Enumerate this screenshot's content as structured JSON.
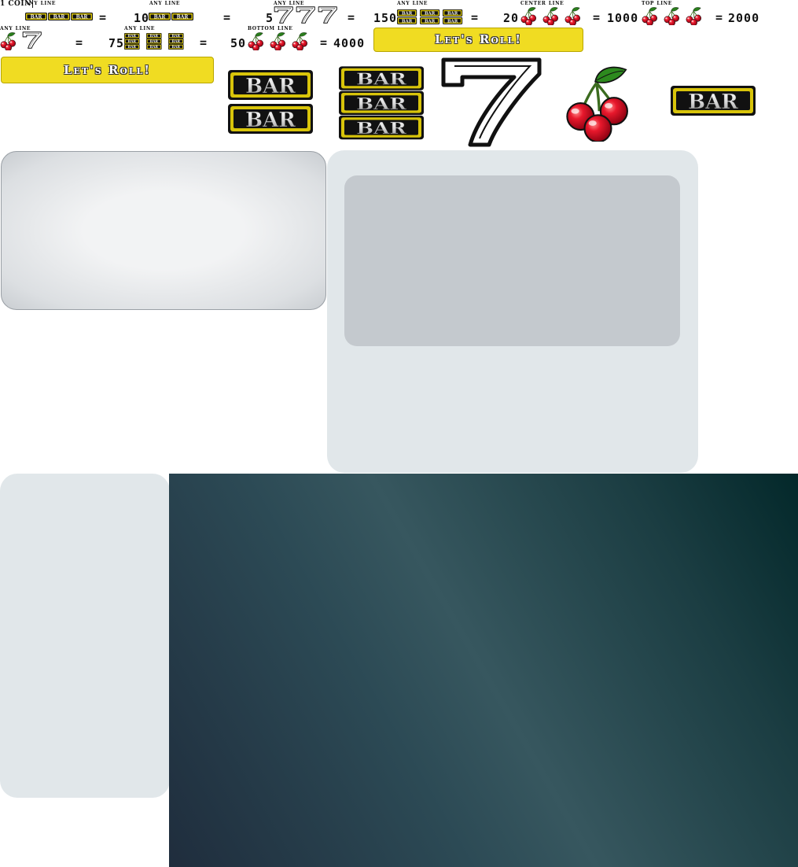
{
  "paytable": {
    "coin_label": "1 COIN",
    "entries": [
      {
        "line": "any line",
        "combo": "bar-bar-bar-icon",
        "payout": ""
      },
      {
        "line": "any line",
        "combo": "bar-bar-icon",
        "payout": "10"
      },
      {
        "line": "any line",
        "combo": "seven-seven-seven-icon",
        "payout": "5"
      },
      {
        "line": "any line",
        "combo": "triple-bar-x3-icon",
        "payout": "150"
      },
      {
        "line": "center line",
        "combo": "cherry-x3-icon",
        "payout": "20"
      },
      {
        "line": "top line",
        "combo": "cherry-x3-icon",
        "payout": "1000"
      },
      {
        "line": "",
        "combo": "",
        "payout": "2000"
      },
      {
        "line": "any line",
        "combo": "cherry-seven-icon",
        "payout": ""
      },
      {
        "line": "any line",
        "combo": "triple-bar-x3-icon",
        "payout": "75"
      },
      {
        "line": "bottom line",
        "combo": "cherry-x3-icon",
        "payout": "50"
      },
      {
        "line": "",
        "combo": "",
        "payout": "4000"
      }
    ],
    "equals": "="
  },
  "buttons": {
    "roll_label": "Let's Roll!"
  },
  "symbols": {
    "bar_text": "BAR"
  },
  "colors": {
    "button_yellow": "#f0dc22",
    "cherry_red": "#e0162b",
    "leaf_green": "#2d8a1e",
    "bar_gold": "#d8c40a"
  }
}
